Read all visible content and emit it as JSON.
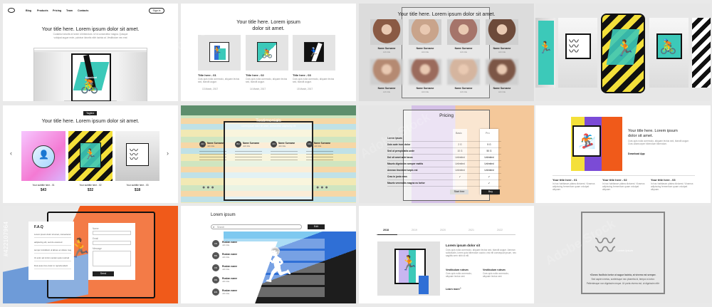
{
  "colors": {
    "accent_orange": "#f05a1a",
    "teal": "#3cc9b9",
    "yellow": "#f4e03a",
    "purple": "#7b4bd6",
    "blue": "#2f6fd6",
    "dark": "#1d1d1d"
  },
  "watermark": "Adobe Stock",
  "stock_id": "#422107964",
  "t1": {
    "nav": [
      "Blog",
      "Products",
      "Pricing",
      "Team",
      "Contacts"
    ],
    "signin": "Sign in",
    "title": "Your title here. Lorem ipsum dolor sit amet.",
    "sub1": "Curabitur lobortis id lorem id bibendum. Ut id consectetur magna. Quisque",
    "sub2": "volutpat augue enim, pulvinar lobortis nibh lacinia at. Vestibulum nec erat",
    "ride_label": "Download"
  },
  "t2": {
    "title": "Your title here. Lorem ipsum",
    "title2": "dolor sit amet.",
    "cards": [
      {
        "title": "Title here - 01",
        "text": "Cras quis nulla commodo, aliquam lectus sed, blandit augue.",
        "date": "13 March, 2017"
      },
      {
        "title": "Title here - 02",
        "text": "Cras quis nulla commodo, aliquam lectus sed, blandit augue.",
        "date": "14 March, 2017"
      },
      {
        "title": "Title here - 03",
        "text": "Cras quis nulla commodo, aliquam lectus sed, blandit augue.",
        "date": "15 March, 2017"
      }
    ]
  },
  "t3": {
    "title": "Your title here. Lorem ipsum dolor sit amet.",
    "people": [
      {
        "name": "Name Surname",
        "role": "Job title"
      },
      {
        "name": "Name Surname",
        "role": "Job title"
      },
      {
        "name": "Name Surname",
        "role": "Job title"
      },
      {
        "name": "Name Surname",
        "role": "Job title"
      },
      {
        "name": "Name Surname",
        "role": "Job title"
      },
      {
        "name": "Name Surname",
        "role": "Job title"
      },
      {
        "name": "Name Surname",
        "role": "Job title"
      },
      {
        "name": "Name Surname",
        "role": "Job title"
      }
    ]
  },
  "t5": {
    "tagline": "Tagline",
    "title": "Your title here. Lorem ipsum dolor sit amet.",
    "products": [
      {
        "name": "Your subtitle here - 01",
        "price": "$43"
      },
      {
        "name": "Your subtitle here - 02",
        "price": "$32"
      },
      {
        "name": "Your subtitle here - 03",
        "price": "$18"
      }
    ]
  },
  "t6": {
    "title": "Testimonials",
    "subtitle": "Lorem ipsum dolor sit amet, consectetur adipiscing elit",
    "people": [
      {
        "initials": "AN",
        "name": "Name Surname",
        "role": "Job title"
      },
      {
        "initials": "BN",
        "name": "Name Surname",
        "role": "Job title"
      },
      {
        "initials": "CN",
        "name": "Name Surname",
        "role": "Job title"
      },
      {
        "initials": "DN",
        "name": "Name Surname",
        "role": "Job title"
      }
    ]
  },
  "t7": {
    "title": "Pricing",
    "plans": [
      "Basic",
      "Pro"
    ],
    "rows": [
      {
        "label": "Lorem ipsum",
        "basic": "",
        "pro": ""
      },
      {
        "label": "Duis aute irure dolor",
        "basic": "2 G",
        "pro": "5 G"
      },
      {
        "label": "Sed ut perspiciatis unde",
        "basic": "10 G",
        "pro": "50 G"
      },
      {
        "label": "Dol sit amet ante lacus",
        "basic": "Unlimited",
        "pro": "Unlimited"
      },
      {
        "label": "Mauris dignissim semper mattis",
        "basic": "Unlimited",
        "pro": "Unlimited"
      },
      {
        "label": "Aenean tincidunt turpis est",
        "basic": "Unlimited",
        "pro": "Unlimited"
      },
      {
        "label": "Cras in justo eros",
        "basic": "✔",
        "pro": "✔"
      },
      {
        "label": "Mauris venenatis magna eu tortor",
        "basic": "",
        "pro": "✔"
      }
    ],
    "basic_btn": "Start free",
    "pro_btn": "Buy"
  },
  "t8": {
    "title": "Your title here. Lorem ipsum",
    "title2": "dolor sit amet.",
    "text": "Cras quis nulla commodo, aliquam lectus sed, blandit augue. Cras ullamcorper bibendum bibendum.",
    "link": "Download App",
    "items": [
      {
        "title": "Your title here - 01",
        "text": "In hac habitasse platea dictumst. Vivamus adipiscing fermentum quam volutpat aliquam."
      },
      {
        "title": "Your title here - 02",
        "text": "In hac habitasse platea dictumst. Vivamus adipiscing fermentum quam volutpat aliquam."
      },
      {
        "title": "Your title here - 03",
        "text": "In hac habitasse platea dictumst. Vivamus adipiscing fermentum quam volutpat aliquam."
      }
    ]
  },
  "t9": {
    "title": "F.A.Q",
    "lines": [
      "Lorem ipsum dolor sit amet, consectetur",
      "adipiscing elit, sed do eiusmod",
      "tempor incididunt ut labore et dolore magna aliqua",
      "Ut enim ad minim veniam quis nostrud",
      "Duis aute irure dolor in reprehenderit"
    ],
    "form": [
      "Name",
      "Email",
      "Message"
    ],
    "send": "Send"
  },
  "t10": {
    "title": "Lorem ipsum",
    "search_placeholder": "Search",
    "search_btn": "Edit",
    "rows": [
      {
        "initials": "AN",
        "name": "Ruslan name",
        "role": "Job title"
      },
      {
        "initials": "BN",
        "name": "Ruslan name",
        "role": "Job title"
      },
      {
        "initials": "CN",
        "name": "Ruslan name",
        "role": "Job title"
      },
      {
        "initials": "DN",
        "name": "Ruslan name",
        "role": "Job title"
      },
      {
        "initials": "EN",
        "name": "Ruslan name",
        "role": "Job title"
      }
    ]
  },
  "t11": {
    "years": [
      "2018",
      "2019",
      "2020",
      "2021",
      "2022"
    ],
    "heading": "Lorem ipsum dolor sit",
    "text": "Cras quis nulla commodo, aliquam lectus sed, blandit augue. Aenean sollicitudin, lorem quis bibendum auctor, nisi elit consequat ipsum, nec sagittis sem nibh id elit.",
    "sub_titles": [
      "Vestibulum rutrum",
      "Vestibulum rutrum"
    ],
    "sub_texts": [
      "Cras quis nulla commodo, aliquam lectus sed.",
      "Cras quis nulla commodo, aliquam lectus sed."
    ],
    "link": "Learn more"
  },
  "t12": {
    "label": "Lorem ipsum",
    "quote1": "«Donec facilisis tortor ut augue lacinia, at viverra est semper.",
    "quote2": "Sed sapien metus, scelerisque nec pharetra id, tempor a tortor.",
    "quote3": "Pellentesque non dignissim neque. Ut porta viverra est, ut dignissim elit»"
  }
}
